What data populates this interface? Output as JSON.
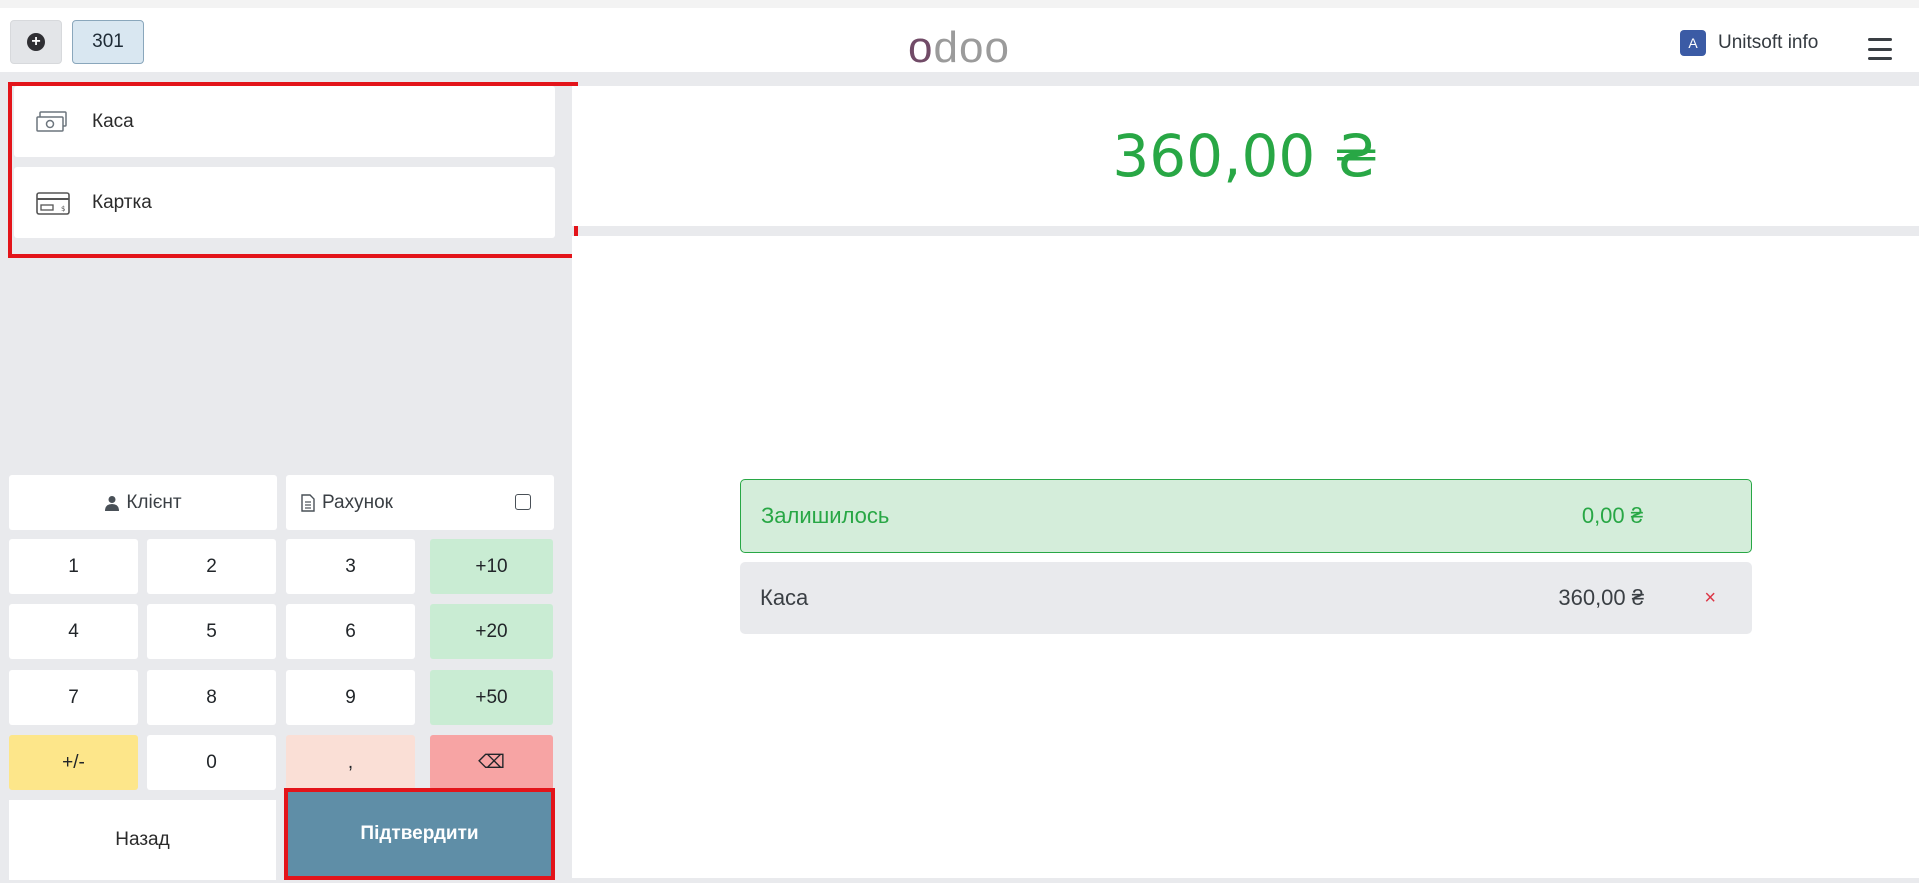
{
  "header": {
    "order_number": "301",
    "logo_letters": [
      "o",
      "d",
      "o",
      "o"
    ],
    "user_initial": "A",
    "user_name": "Unitsoft info"
  },
  "payment_methods": [
    {
      "label": "Каса",
      "icon": "cash-icon"
    },
    {
      "label": "Картка",
      "icon": "credit-card-icon"
    }
  ],
  "customer_button": "Клієнт",
  "invoice_button": "Рахунок",
  "numpad": [
    [
      "1",
      "2",
      "3",
      "+10"
    ],
    [
      "4",
      "5",
      "6",
      "+20"
    ],
    [
      "7",
      "8",
      "9",
      "+50"
    ],
    [
      "+/-",
      "0",
      ",",
      "⌫"
    ]
  ],
  "back_label": "Назад",
  "confirm_label": "Підтвердити",
  "total_due": "360,00 ₴",
  "remaining": {
    "label": "Залишилось",
    "amount": "0,00 ₴"
  },
  "payment_lines": [
    {
      "method": "Каса",
      "amount": "360,00 ₴",
      "delete": "×"
    }
  ],
  "colors": {
    "accent_green": "#28a745",
    "confirm_blue": "#5f8ea7",
    "highlight_red": "#e3141a"
  }
}
